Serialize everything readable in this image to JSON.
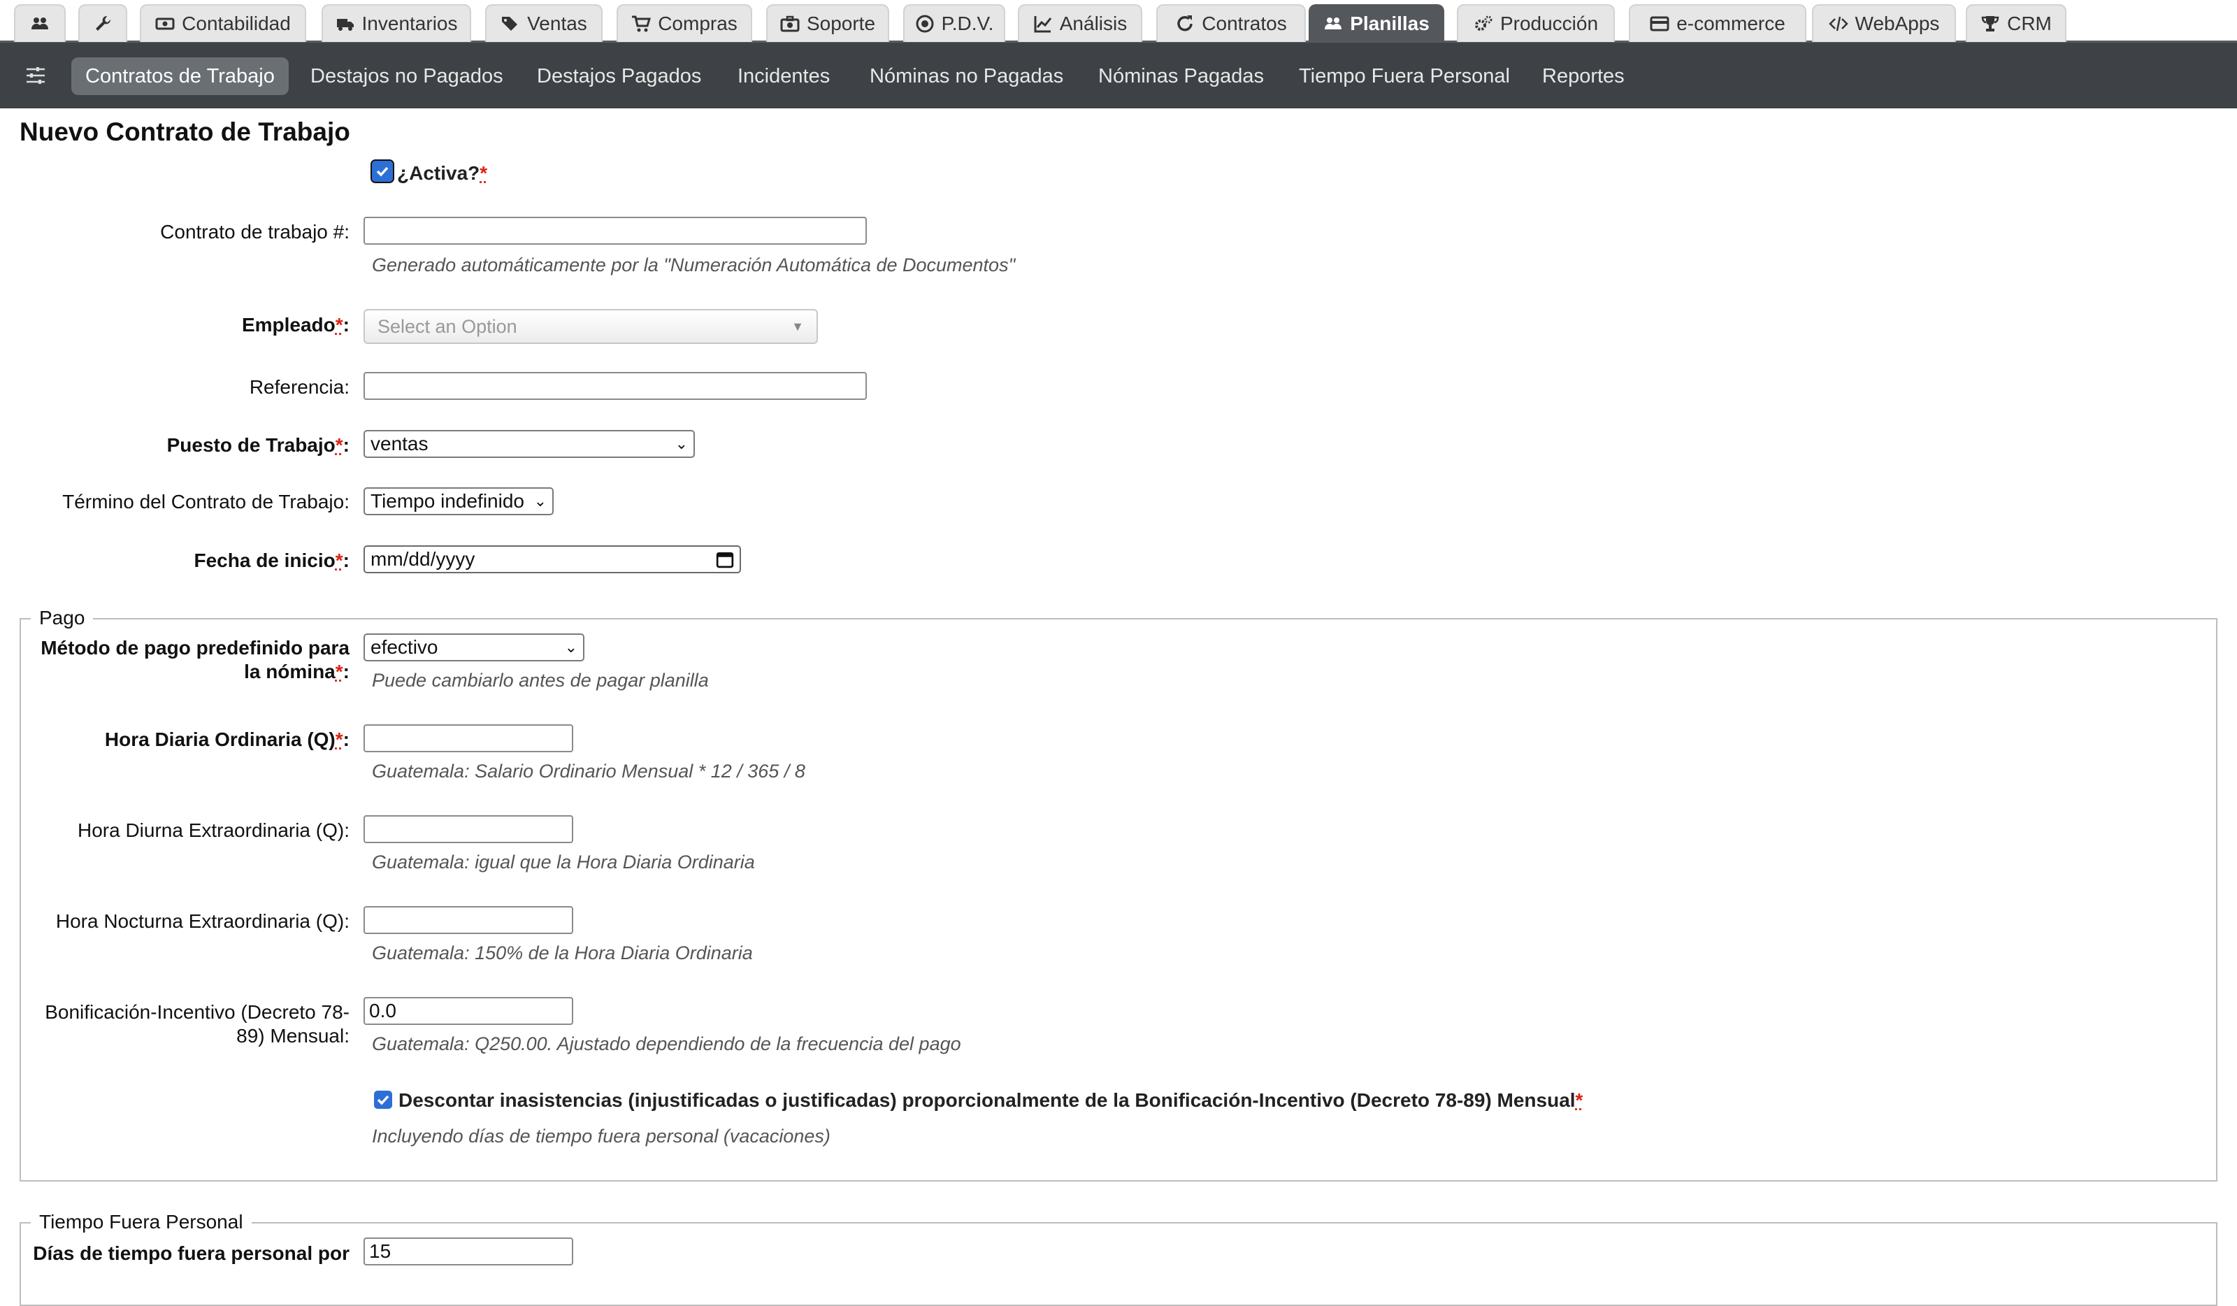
{
  "top_tabs": [
    {
      "label": "",
      "icon": "users-icon"
    },
    {
      "label": "",
      "icon": "wrench-icon"
    },
    {
      "label": "Contabilidad",
      "icon": "money-icon"
    },
    {
      "label": "Inventarios",
      "icon": "truck-icon"
    },
    {
      "label": "Ventas",
      "icon": "tags-icon"
    },
    {
      "label": "Compras",
      "icon": "cart-icon"
    },
    {
      "label": "Soporte",
      "icon": "medkit-icon"
    },
    {
      "label": "P.D.V.",
      "icon": "target-icon"
    },
    {
      "label": "Análisis",
      "icon": "line-chart-icon"
    },
    {
      "label": "Contratos",
      "icon": "refresh-icon"
    },
    {
      "label": "Planillas",
      "icon": "users-icon",
      "active": true
    },
    {
      "label": "Producción",
      "icon": "gears-icon"
    },
    {
      "label": "e-commerce",
      "icon": "credit-card-icon"
    },
    {
      "label": "WebApps",
      "icon": "code-icon"
    },
    {
      "label": "CRM",
      "icon": "trophy-icon"
    }
  ],
  "subnav": {
    "menu_icon": "sliders-icon",
    "items": [
      "Contratos de Trabajo",
      "Destajos no Pagados",
      "Destajos Pagados",
      "Incidentes",
      "Nóminas no Pagadas",
      "Nóminas Pagadas",
      "Tiempo Fuera Personal",
      "Reportes"
    ],
    "active_index": 0
  },
  "page": {
    "title": "Nuevo Contrato de Trabajo"
  },
  "form": {
    "activa": {
      "label": "¿Activa?",
      "req": "*",
      "checked": true
    },
    "contrato_num": {
      "label": "Contrato de trabajo #:",
      "value": "",
      "hint": "Generado automáticamente por la \"Numeración Automática de Documentos\""
    },
    "empleado": {
      "label": "Empleado",
      "req": "*",
      "colon": ":",
      "placeholder": "Select an Option"
    },
    "referencia": {
      "label": "Referencia:",
      "value": ""
    },
    "puesto": {
      "label": "Puesto de Trabajo",
      "req": "*",
      "colon": ":",
      "value": "ventas"
    },
    "termino": {
      "label": "Término del Contrato de Trabajo:",
      "value": "Tiempo indefinido"
    },
    "fecha_inicio": {
      "label": "Fecha de inicio",
      "req": "*",
      "colon": ":",
      "placeholder": "mm/dd/yyyy"
    }
  },
  "pago": {
    "legend": "Pago",
    "metodo": {
      "label": "Método de pago predefinido para la nómina",
      "req": "*",
      "colon": ":",
      "value": "efectivo",
      "hint": "Puede cambiarlo antes de pagar planilla"
    },
    "hora_diaria": {
      "label": "Hora Diaria Ordinaria (Q)",
      "req": "*",
      "colon": ":",
      "value": "",
      "hint": "Guatemala: Salario Ordinario Mensual * 12 / 365 / 8"
    },
    "hora_diurna": {
      "label": "Hora Diurna Extraordinaria (Q):",
      "value": "",
      "hint": "Guatemala: igual que la Hora Diaria Ordinaria"
    },
    "hora_nocturna": {
      "label": "Hora Nocturna Extraordinaria (Q):",
      "value": "",
      "hint": "Guatemala: 150% de la Hora Diaria Ordinaria"
    },
    "bonificacion": {
      "label": "Bonificación-Incentivo (Decreto 78-89) Mensual:",
      "value": "0.0",
      "hint": "Guatemala: Q250.00. Ajustado dependiendo de la frecuencia del pago"
    },
    "descontar": {
      "label": "Descontar inasistencias (injustificadas o justificadas) proporcionalmente de la Bonificación-Incentivo (Decreto 78-89) Mensual",
      "req": "*",
      "checked": true,
      "hint": "Incluyendo días de tiempo fuera personal (vacaciones)"
    }
  },
  "tiempo_fuera": {
    "legend": "Tiempo Fuera Personal",
    "dias": {
      "label": "Días de tiempo fuera personal por",
      "value": "15"
    }
  }
}
